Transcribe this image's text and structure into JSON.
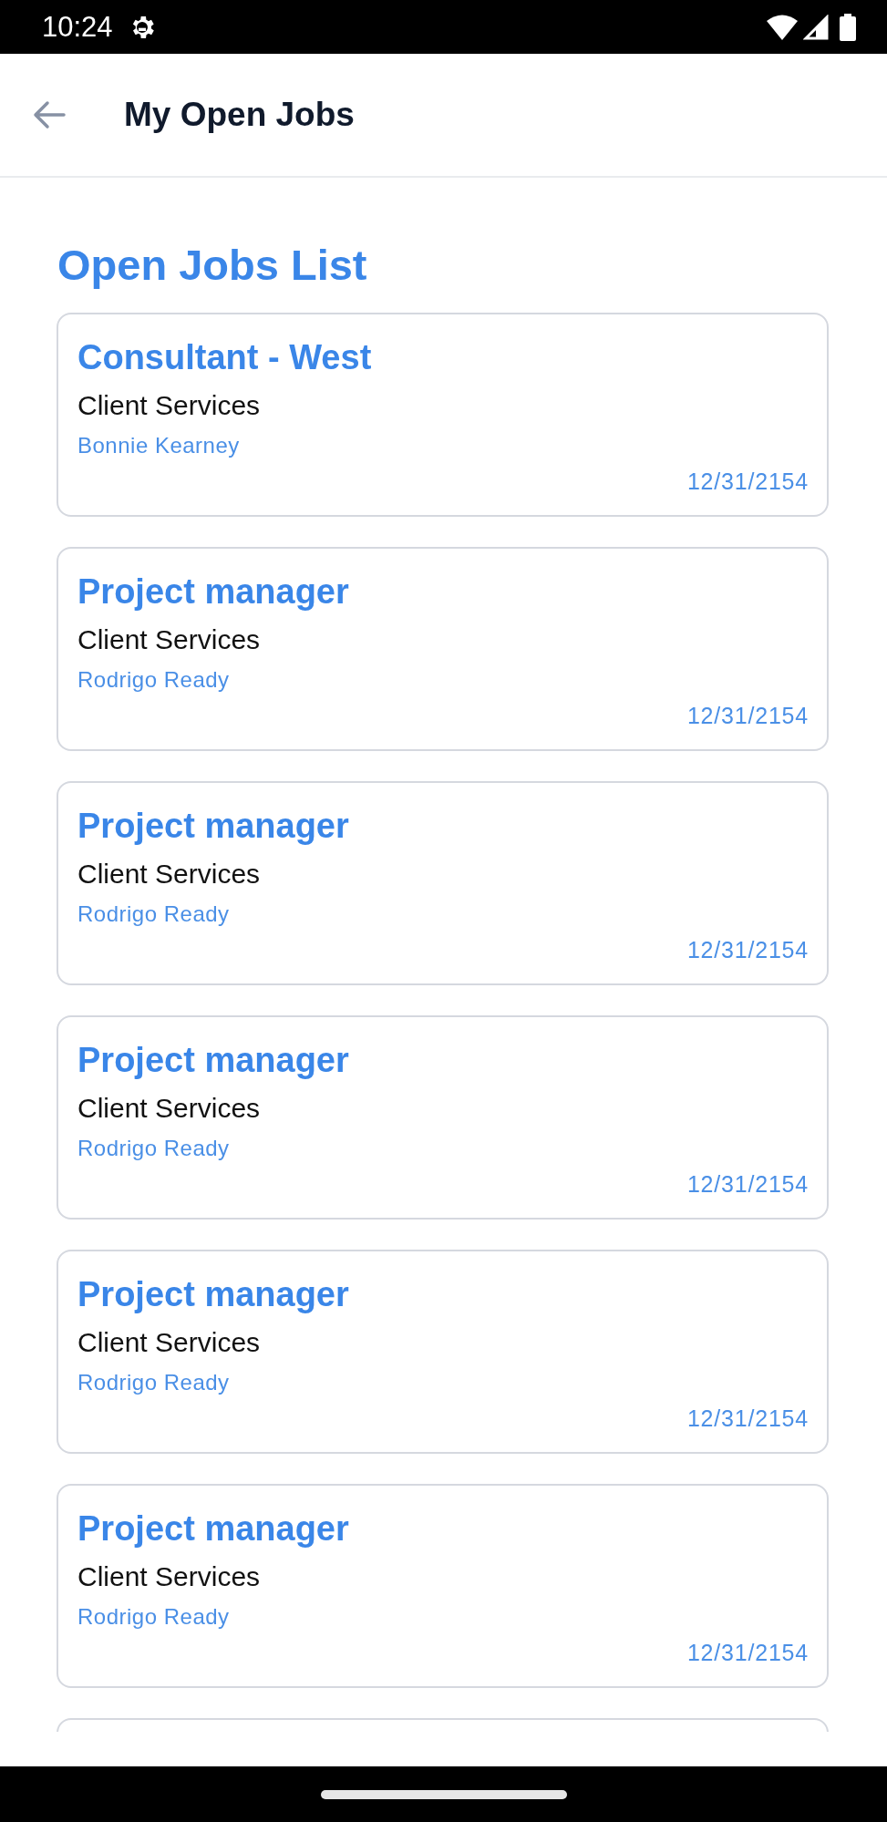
{
  "status_bar": {
    "time": "10:24"
  },
  "app_bar": {
    "title": "My Open Jobs"
  },
  "heading": "Open Jobs List",
  "jobs": [
    {
      "title": "Consultant - West",
      "department": "Client Services",
      "contact": "Bonnie Kearney",
      "date": "12/31/2154"
    },
    {
      "title": "Project manager",
      "department": "Client Services",
      "contact": "Rodrigo Ready",
      "date": "12/31/2154"
    },
    {
      "title": "Project manager",
      "department": "Client Services",
      "contact": "Rodrigo Ready",
      "date": "12/31/2154"
    },
    {
      "title": "Project manager",
      "department": "Client Services",
      "contact": "Rodrigo Ready",
      "date": "12/31/2154"
    },
    {
      "title": "Project manager",
      "department": "Client Services",
      "contact": "Rodrigo Ready",
      "date": "12/31/2154"
    },
    {
      "title": "Project manager",
      "department": "Client Services",
      "contact": "Rodrigo Ready",
      "date": "12/31/2154"
    }
  ],
  "more_below": true
}
